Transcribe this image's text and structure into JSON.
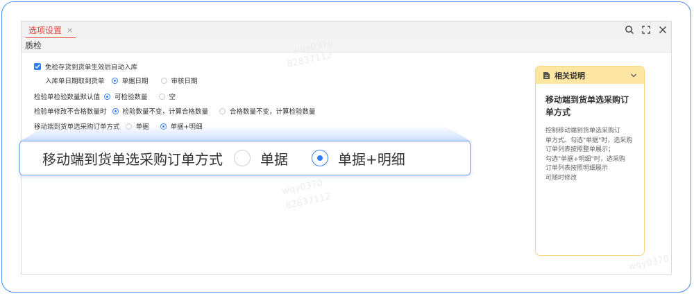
{
  "tab": {
    "label": "选项设置",
    "close": "×"
  },
  "section": {
    "title": "质检"
  },
  "settings": {
    "auto_stock_label": "免检存货到货单生效后自动入库",
    "inbound_date": {
      "label": "入库单日期取到货单",
      "opt1": "单据日期",
      "opt2": "审核日期"
    },
    "default_qty": {
      "label": "检验单检验数量默认值",
      "opt1": "可检验数量",
      "opt2": "空"
    },
    "modify_fail": {
      "label": "检验单修改不合格数量时",
      "opt1": "检验数量不变，计算合格数量",
      "opt2": "合格数量不变，计算检验数量"
    },
    "mobile_mode": {
      "label": "移动端到货单选采购订单方式",
      "opt1": "单据",
      "opt2": "单据+明细"
    }
  },
  "zoom": {
    "label": "移动端到货单选采购订单方式",
    "opt1": "单据",
    "opt2": "单据+明细"
  },
  "help": {
    "title": "相关说明",
    "subtitle": "移动端到货单选采购订单方式",
    "lines": [
      "控制移动端到货单选采购订",
      "单方式。勾选\"单据\"时，选采购",
      "订单列表按照整单展示；",
      "勾选\"单据+明细\"时，选采购",
      "订单列表按照明细展示",
      "可随时修改"
    ]
  },
  "watermark": {
    "text1": "wqy0370",
    "text2": "82837112"
  },
  "colors": {
    "accent": "#2f7cf6",
    "tab_red": "#e8413b",
    "help_header": "#fde6a2",
    "frame": "#4b8cf0"
  },
  "icons": {
    "search": "search-icon",
    "fullscreen": "fullscreen-icon",
    "close": "close-icon",
    "doc": "document-icon",
    "chevron": "chevron-down-icon"
  }
}
